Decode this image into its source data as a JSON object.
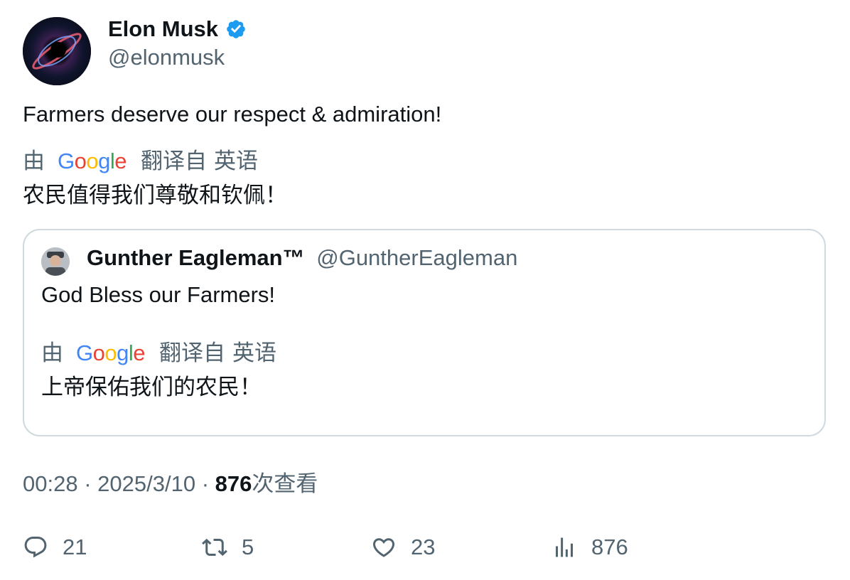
{
  "author": {
    "name": "Elon Musk",
    "handle": "@elonmusk",
    "verified_color": "#1d9bf0",
    "avatar_icon": "black-hole-avatar"
  },
  "tweet": {
    "text": "Farmers deserve our respect & admiration!",
    "translation": {
      "by_label": "由",
      "provider": "Google",
      "translated_from": "翻译自",
      "source_language": "英语",
      "text": "农民值得我们尊敬和钦佩！"
    }
  },
  "quote": {
    "name": "Gunther Eagleman™",
    "handle": "@GuntherEagleman",
    "text": "God Bless our Farmers!",
    "translation": {
      "by_label": "由",
      "provider": "Google",
      "translated_from": "翻译自",
      "source_language": "英语",
      "text": "上帝保佑我们的农民！"
    }
  },
  "meta": {
    "time": "00:28",
    "separator": "·",
    "date": "2025/3/10",
    "views": "876",
    "views_label": "次查看"
  },
  "actions": {
    "replies": "21",
    "reposts": "5",
    "likes": "23",
    "views": "876"
  },
  "colors": {
    "text_primary": "#0f1419",
    "text_secondary": "#536471",
    "border": "#cfd9de"
  }
}
